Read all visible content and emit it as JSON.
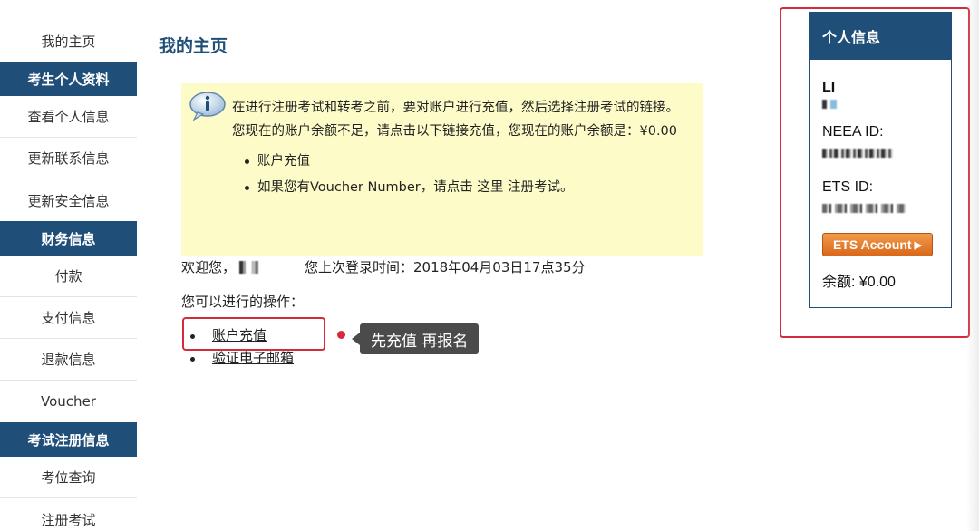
{
  "sidebar": {
    "items": [
      {
        "type": "link",
        "label": "我的主页"
      },
      {
        "type": "header",
        "label": "考生个人资料"
      },
      {
        "type": "link",
        "label": "查看个人信息"
      },
      {
        "type": "link",
        "label": "更新联系信息"
      },
      {
        "type": "link",
        "label": "更新安全信息"
      },
      {
        "type": "header",
        "label": "财务信息"
      },
      {
        "type": "link",
        "label": "付款"
      },
      {
        "type": "link",
        "label": "支付信息"
      },
      {
        "type": "link",
        "label": "退款信息"
      },
      {
        "type": "link",
        "label": "Voucher"
      },
      {
        "type": "header",
        "label": "考试注册信息"
      },
      {
        "type": "link",
        "label": "考位查询"
      },
      {
        "type": "link",
        "label": "注册考试"
      }
    ]
  },
  "main": {
    "title": "我的主页",
    "notice": {
      "text": "在进行注册考试和转考之前，要对账户进行充值，然后选择注册考试的链接。您现在的账户余额不足，请点击以下链接充值，您现在的账户余额是：¥0.00",
      "bullets": [
        "账户充值",
        "如果您有Voucher Number，请点击 这里 注册考试。"
      ]
    },
    "welcome": {
      "prefix": "欢迎您，",
      "last_login": "您上次登录时间：2018年04月03日17点35分"
    },
    "ops_label": "您可以进行的操作：",
    "ops": [
      "账户充值",
      "验证电子邮箱"
    ],
    "tooltip": "先充值 再报名"
  },
  "panel": {
    "header": "个人信息",
    "name": "LI",
    "neea_label": "NEEA ID:",
    "ets_label": "ETS ID:",
    "ets_button": "ETS Account",
    "ets_button_arrow": "▶",
    "balance": "余额: ¥0.00"
  },
  "colors": {
    "navy": "#1f4e78",
    "notice_bg": "#fdfcc8",
    "highlight_red": "#d42a3c",
    "ets_orange": "#e07a2a"
  },
  "icons": {
    "notice": "info-icon"
  }
}
